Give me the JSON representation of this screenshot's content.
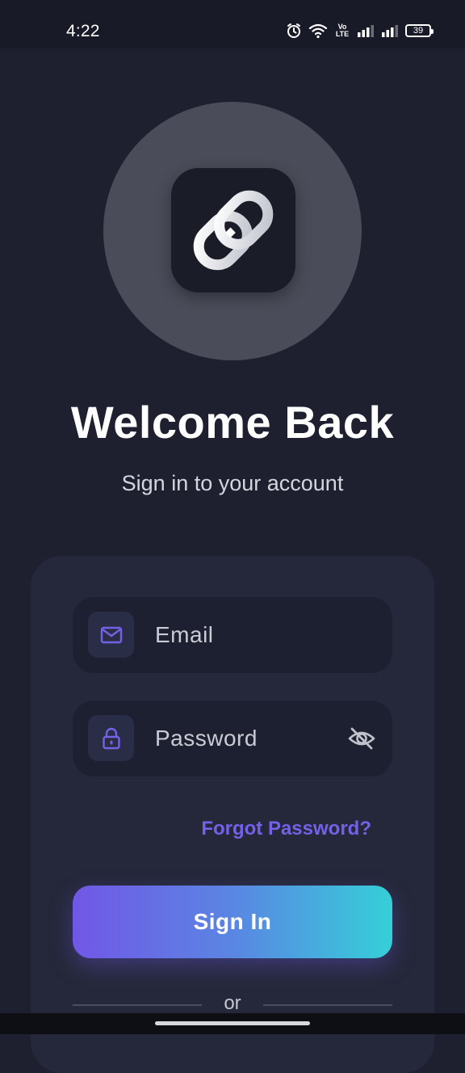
{
  "status_bar": {
    "time": "4:22",
    "volte_label_top": "Vo",
    "volte_label_bottom": "LTE",
    "battery_level": "39",
    "icons": [
      "alarm-icon",
      "wifi-icon",
      "volte-icon",
      "signal-icon",
      "signal-icon",
      "battery-icon"
    ]
  },
  "logo": {
    "icon": "chain-link-icon",
    "circle_color": "#4a4c59",
    "tile_color": "#1a1c28"
  },
  "header": {
    "title": "Welcome Back",
    "subtitle": "Sign in to your account"
  },
  "form": {
    "email": {
      "icon": "mail-icon",
      "placeholder": "Email",
      "value": ""
    },
    "password": {
      "icon": "lock-icon",
      "placeholder": "Password",
      "value": "",
      "toggle_icon": "eye-off-icon"
    },
    "forgot_password_label": "Forgot Password?",
    "sign_in_label": "Sign In",
    "divider_label": "or"
  },
  "colors": {
    "background": "#1e2030",
    "card": "#25283a",
    "field": "#1d2030",
    "accent": "#7561e8",
    "gradient_start": "#7157e6",
    "gradient_end": "#35cfd8"
  }
}
